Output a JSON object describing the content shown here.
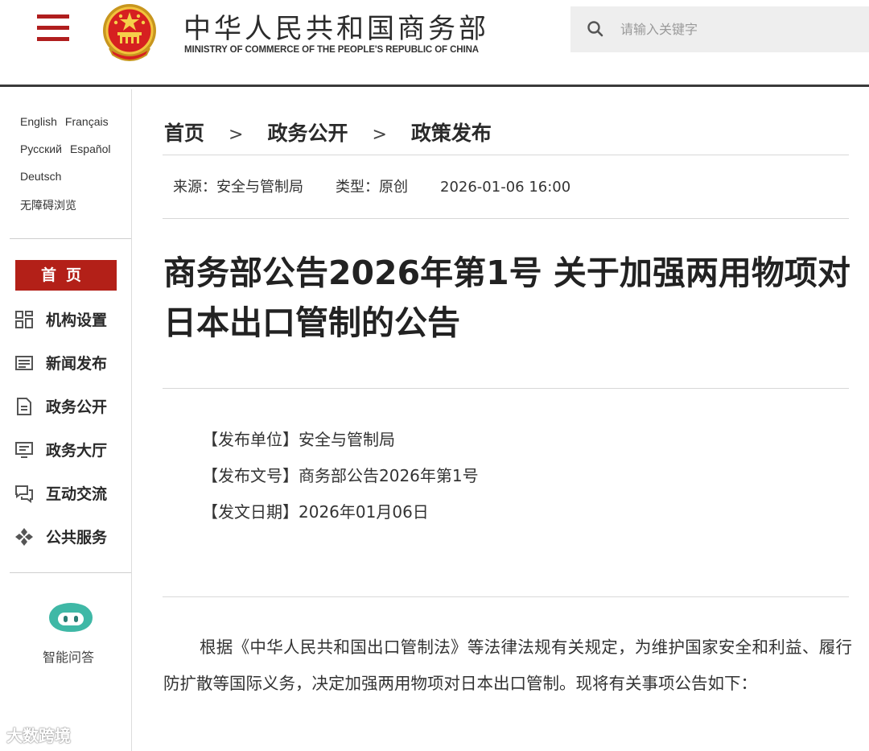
{
  "header": {
    "site_title_cn": "中华人民共和国商务部",
    "site_title_en": "MINISTRY OF COMMERCE OF THE PEOPLE'S REPUBLIC OF CHINA",
    "search_placeholder": "请输入关键字",
    "accent_color": "#b01e1e"
  },
  "sidebar": {
    "languages": {
      "english": "English",
      "francais": "Français",
      "russian": "Русский",
      "espanol": "Español",
      "deutsch": "Deutsch",
      "accessibility": "无障碍浏览"
    },
    "home_label": "首页",
    "nav_items": [
      {
        "label": "机构设置",
        "icon": "org-grid-icon"
      },
      {
        "label": "新闻发布",
        "icon": "news-icon"
      },
      {
        "label": "政务公开",
        "icon": "document-icon"
      },
      {
        "label": "政务大厅",
        "icon": "hall-screen-icon"
      },
      {
        "label": "互动交流",
        "icon": "chat-icon"
      },
      {
        "label": "公共服务",
        "icon": "service-icon"
      }
    ],
    "assistant_label": "智能问答"
  },
  "breadcrumb": {
    "items": [
      "首页",
      "政务公开",
      "政策发布"
    ],
    "separator": ">"
  },
  "meta": {
    "source": "来源：安全与管制局",
    "type": "类型：原创",
    "datetime": "2026-01-06 16:00"
  },
  "article": {
    "title": "商务部公告2026年第1号 关于加强两用物项对日本出口管制的公告",
    "publisher": "【发布单位】安全与管制局",
    "doc_number": "【发布文号】商务部公告2026年第1号",
    "issue_date": "【发文日期】2026年01月06日",
    "body": "根据《中华人民共和国出口管制法》等法律法规有关规定，为维护国家安全和利益、履行防扩散等国际义务，决定加强两用物项对日本出口管制。现将有关事项公告如下："
  },
  "watermark": "大数跨境"
}
